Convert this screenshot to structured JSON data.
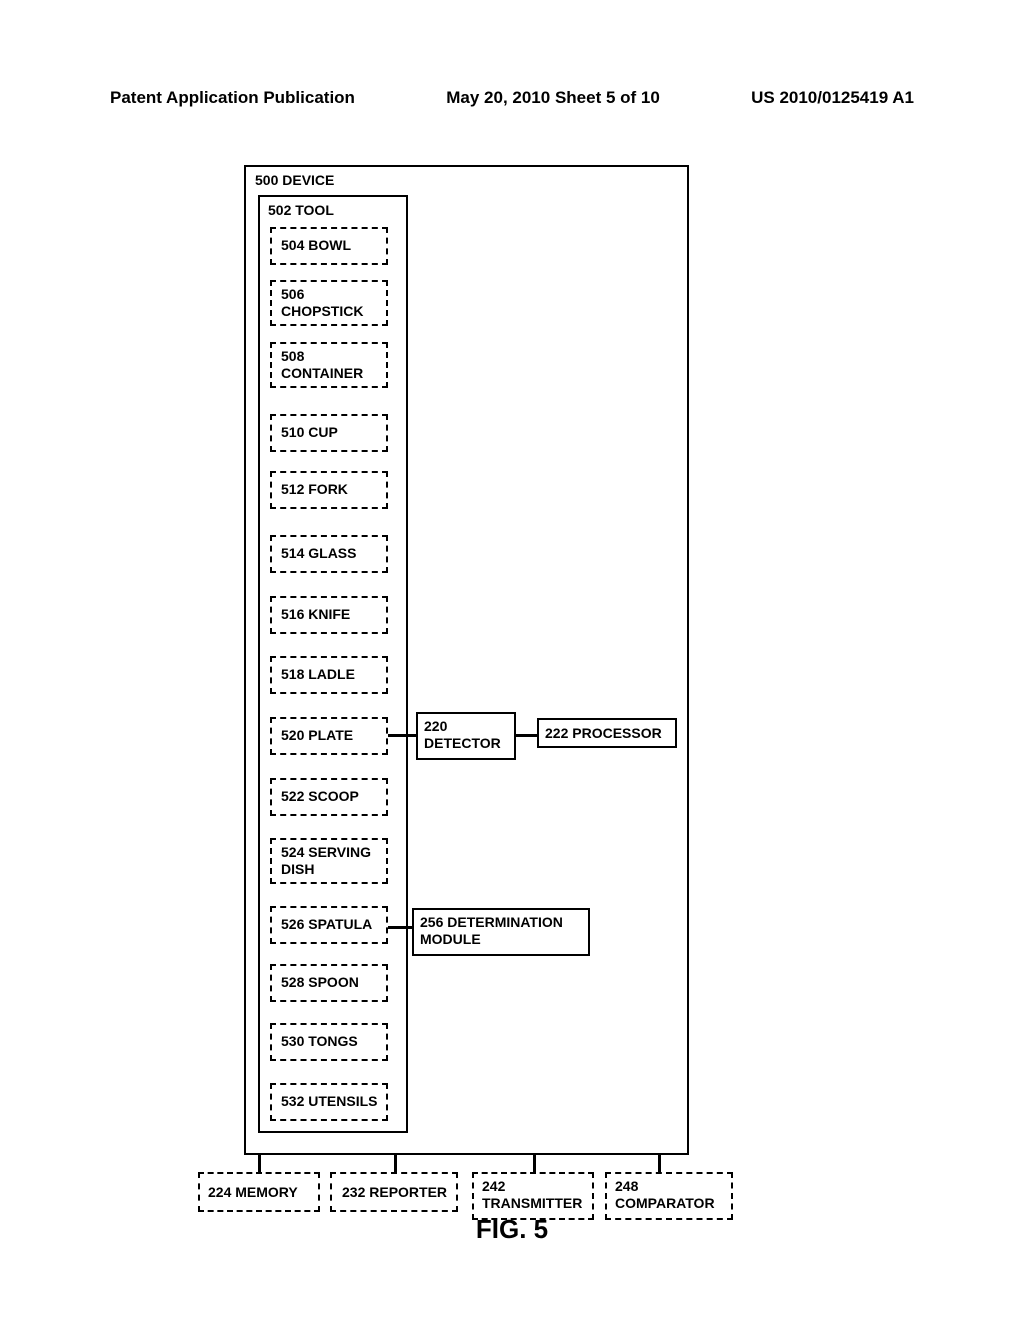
{
  "header": {
    "left": "Patent Application Publication",
    "center": "May 20, 2010  Sheet 5 of 10",
    "right": "US 2010/0125419 A1"
  },
  "figure_label": "FIG. 5",
  "device": {
    "label": "500 DEVICE"
  },
  "tool": {
    "label": "502 TOOL"
  },
  "items": [
    {
      "label": "504 BOWL"
    },
    {
      "label": "506 CHOPSTICK"
    },
    {
      "label": "508 CONTAINER"
    },
    {
      "label": "510 CUP"
    },
    {
      "label": "512 FORK"
    },
    {
      "label": "514 GLASS"
    },
    {
      "label": "516 KNIFE"
    },
    {
      "label": "518 LADLE"
    },
    {
      "label": "520 PLATE"
    },
    {
      "label": "522 SCOOP"
    },
    {
      "label": "524 SERVING DISH"
    },
    {
      "label": "526 SPATULA"
    },
    {
      "label": "528 SPOON"
    },
    {
      "label": "530 TONGS"
    },
    {
      "label": "532 UTENSILS"
    }
  ],
  "detector": {
    "label": "220 DETECTOR"
  },
  "processor": {
    "label": "222 PROCESSOR"
  },
  "determination": {
    "label": "256 DETERMINATION MODULE"
  },
  "memory": {
    "label": "224 MEMORY"
  },
  "reporter": {
    "label": "232 REPORTER"
  },
  "transmitter": {
    "label": "242 TRANSMITTER"
  },
  "comparator": {
    "label": "248 COMPARATOR"
  }
}
